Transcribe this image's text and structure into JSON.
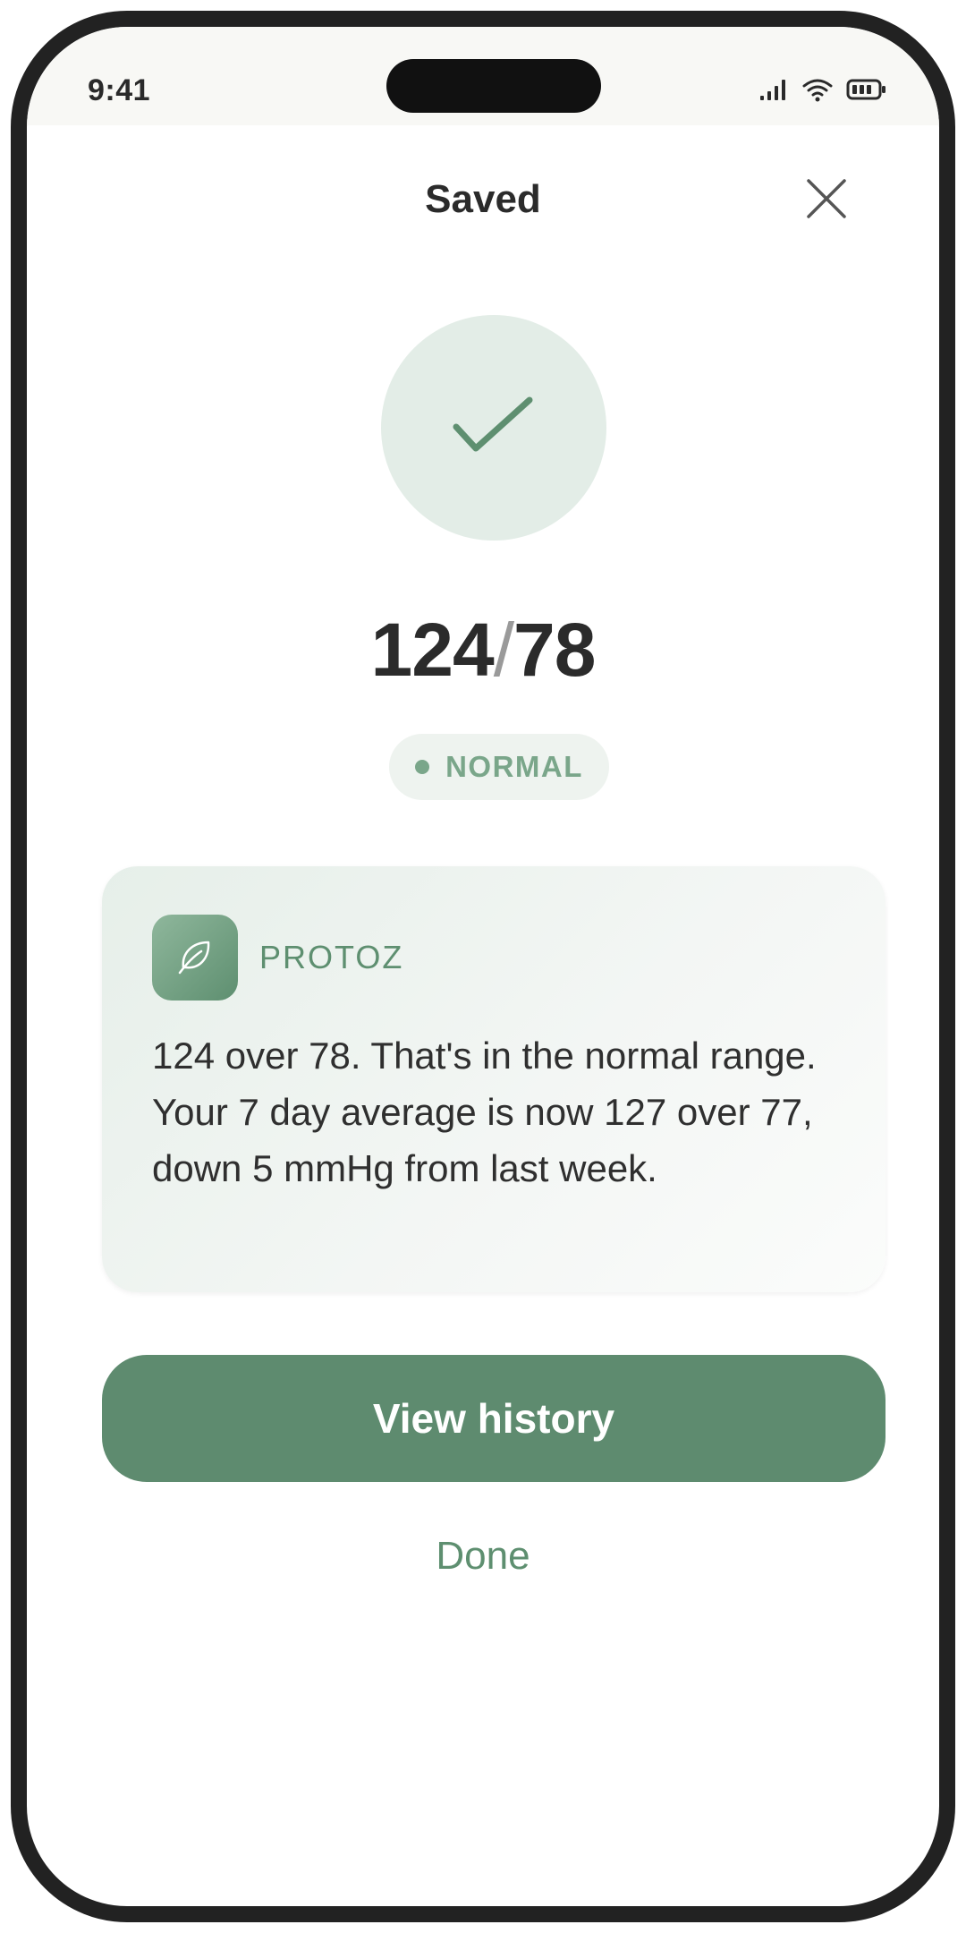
{
  "status_bar": {
    "time": "9:41",
    "icons": [
      "signal-icon",
      "wifi-icon",
      "battery-icon"
    ]
  },
  "header": {
    "title": "Saved",
    "close_icon": "close-icon"
  },
  "result": {
    "icon": "check-icon",
    "systolic": "124",
    "separator": "/",
    "diastolic": "78",
    "status_label": "NORMAL"
  },
  "assistant": {
    "name": "PROTOZ",
    "avatar_icon": "leaf-icon",
    "message": "124 over 78. That's in the normal range. Your 7 day average is now 127 over 77, down 5 mmHg from last week."
  },
  "actions": {
    "primary_label": "View history",
    "secondary_label": "Done"
  },
  "colors": {
    "accent": "#5e8b6f",
    "accent_light": "#e3ede7",
    "text": "#2b2b2b"
  }
}
